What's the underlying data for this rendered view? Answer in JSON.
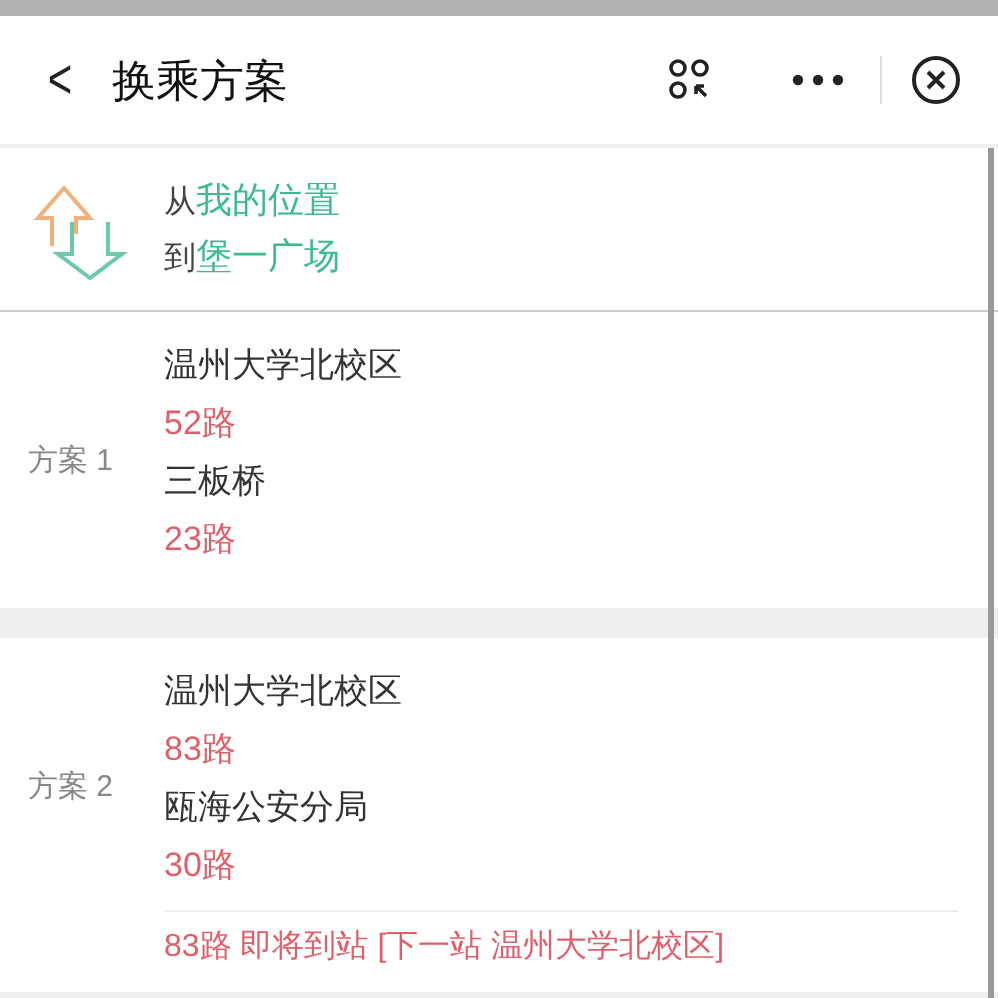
{
  "header": {
    "back": "<",
    "title": "换乘方案"
  },
  "route": {
    "from_prefix": "从",
    "from": "我的位置",
    "to_prefix": "到",
    "to": "堡一广场"
  },
  "plans": [
    {
      "label": "方案 1",
      "steps": [
        {
          "kind": "stop",
          "text": "温州大学北校区"
        },
        {
          "kind": "line",
          "text": "52路"
        },
        {
          "kind": "stop",
          "text": "三板桥"
        },
        {
          "kind": "line",
          "text": "23路"
        }
      ]
    },
    {
      "label": "方案 2",
      "steps": [
        {
          "kind": "stop",
          "text": "温州大学北校区"
        },
        {
          "kind": "line",
          "text": "83路"
        },
        {
          "kind": "stop",
          "text": "瓯海公安分局"
        },
        {
          "kind": "line",
          "text": "30路"
        }
      ],
      "notice": "83路 即将到站 [下一站 温州大学北校区]"
    }
  ]
}
